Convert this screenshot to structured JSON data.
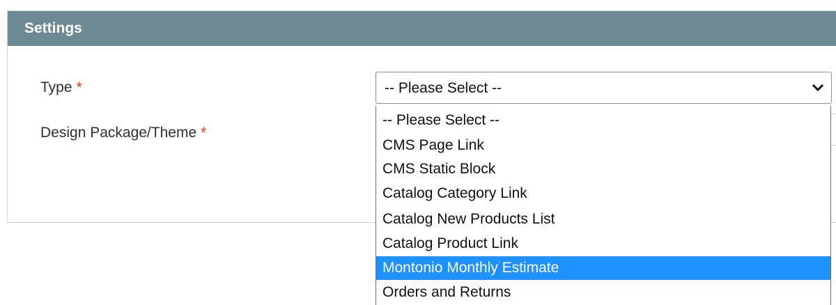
{
  "panel": {
    "title": "Settings"
  },
  "fields": {
    "type_label": "Type",
    "theme_label": "Design Package/Theme",
    "required_mark": "*"
  },
  "type_select": {
    "value": "-- Please Select --",
    "arrow_icon": "chevron-down-icon",
    "options": [
      "-- Please Select --",
      "CMS Page Link",
      "CMS Static Block",
      "Catalog Category Link",
      "Catalog New Products List",
      "Catalog Product Link",
      "Montonio Monthly Estimate",
      "Orders and Returns"
    ],
    "highlighted_option": "Montonio Monthly Estimate"
  },
  "colors": {
    "header_bg": "#6f8992",
    "required": "#eb340a",
    "highlight": "#1e90ff"
  }
}
